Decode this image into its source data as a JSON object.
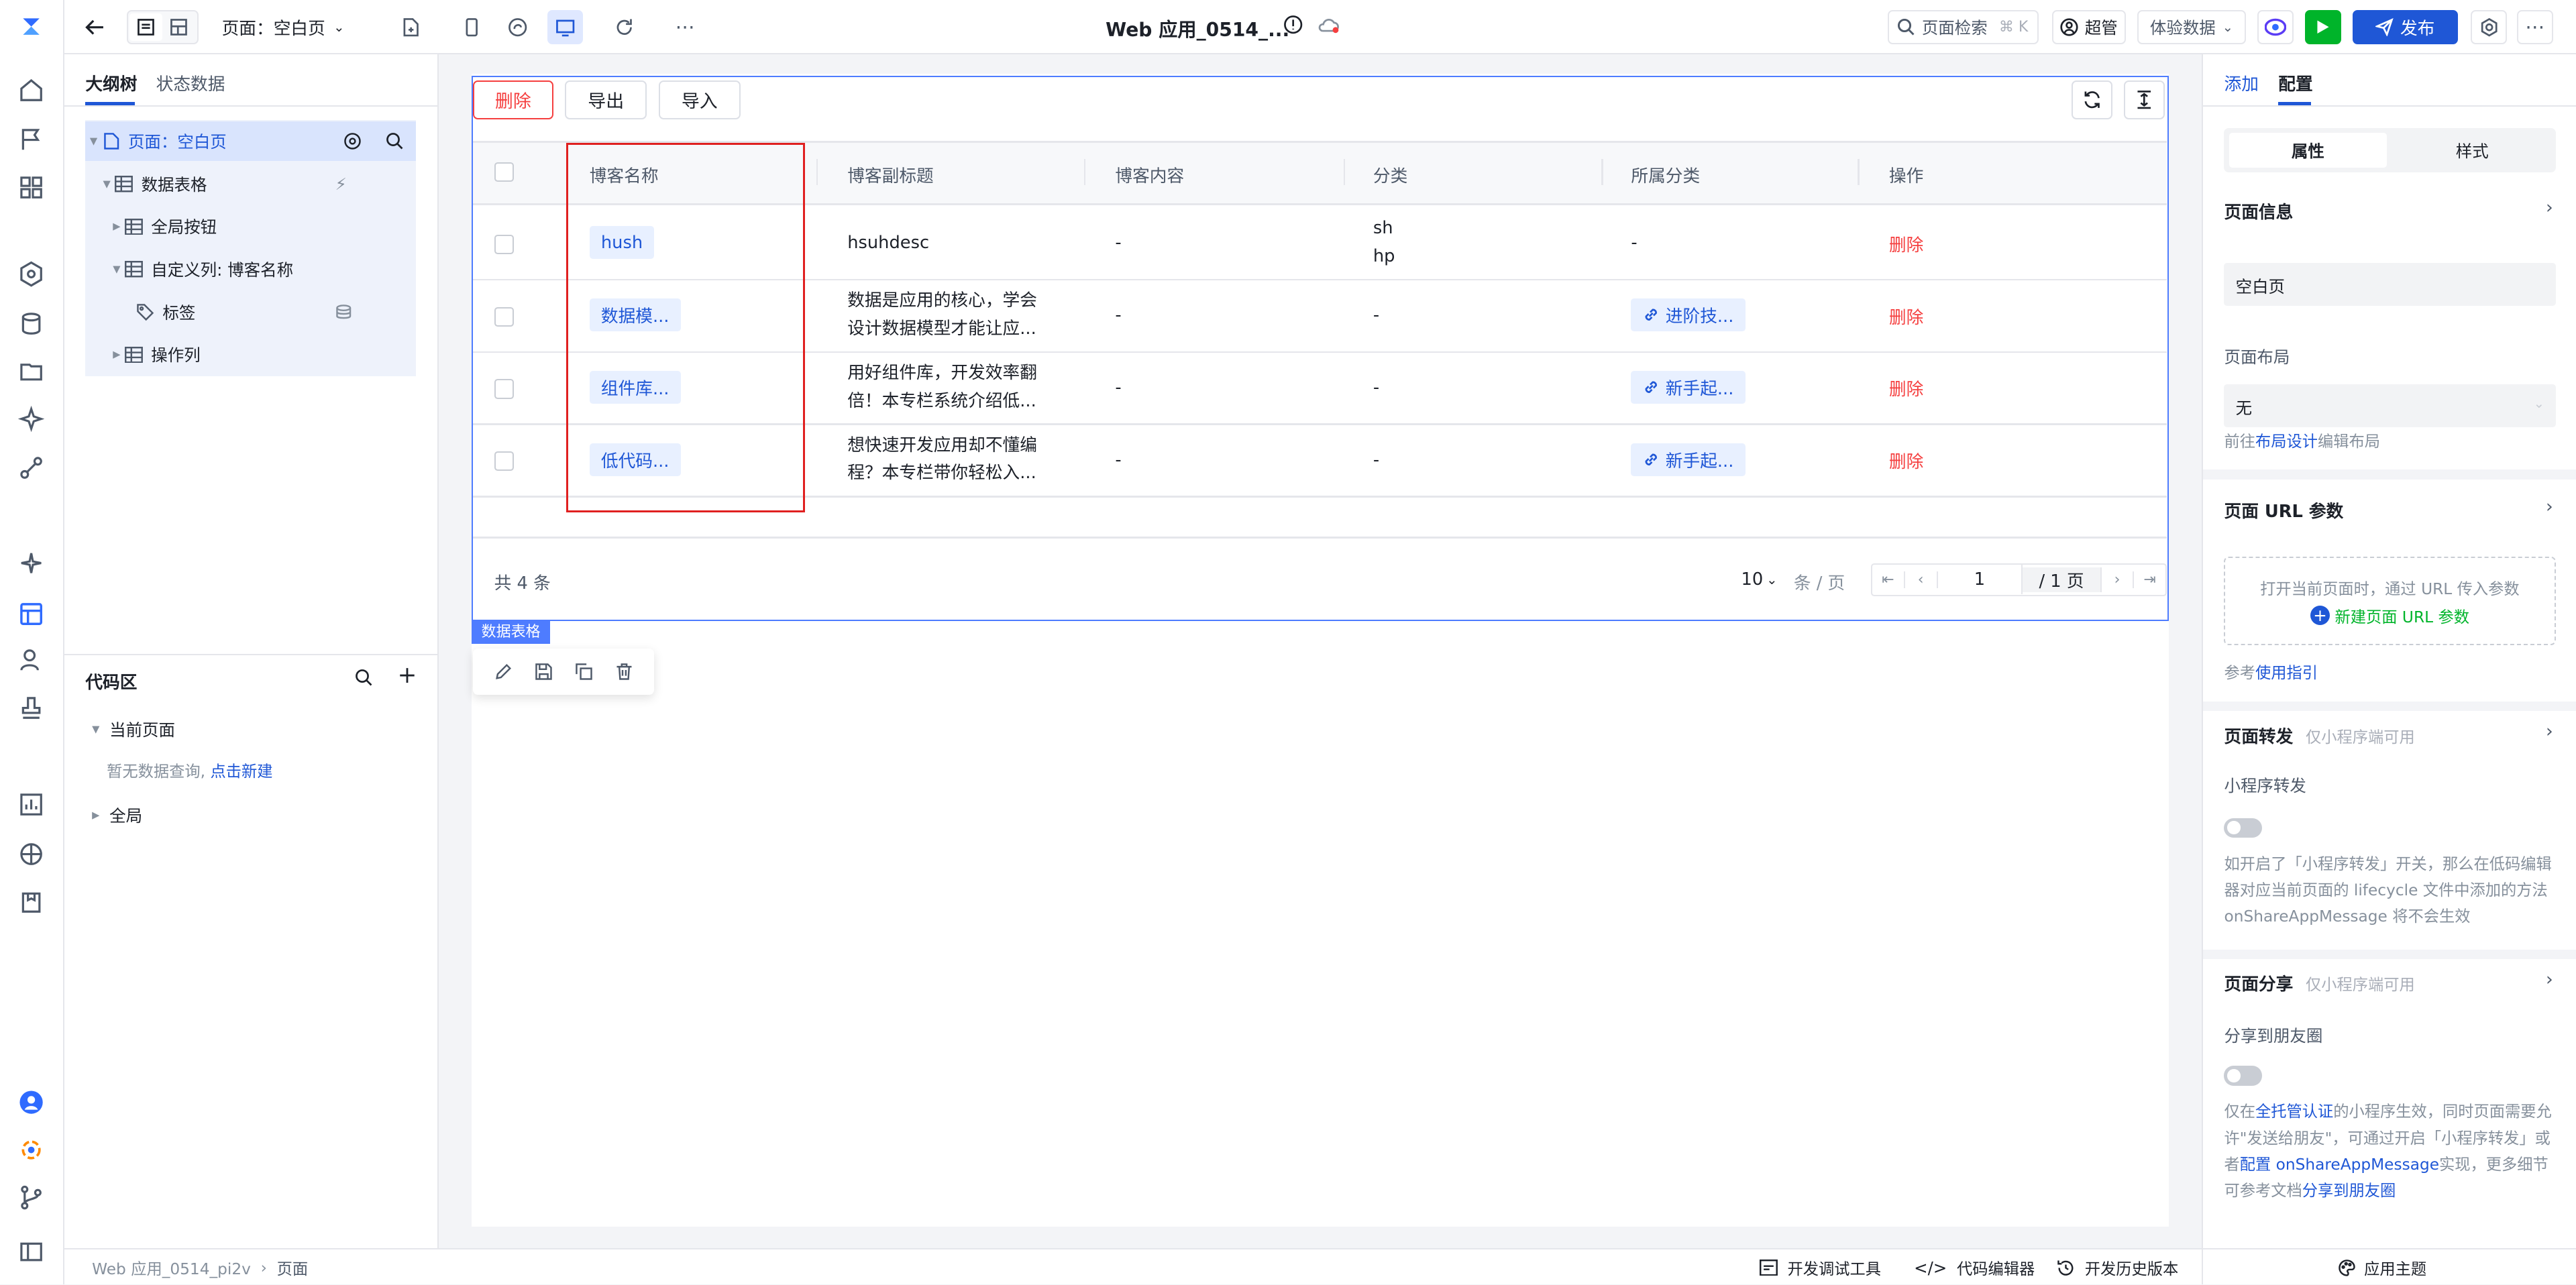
{
  "topbar": {
    "page_selector": "页面：空白页",
    "app_title": "Web 应用_0514_...",
    "search_label": "页面检索",
    "search_shortcut": "⌘ K",
    "user_label": "超管",
    "data_mode": "体验数据",
    "publish_label": "发布"
  },
  "outline": {
    "tabs": [
      "大纲树",
      "状态数据"
    ],
    "tree": [
      {
        "label": "页面：空白页"
      },
      {
        "label": "数据表格"
      },
      {
        "label": "全局按钮"
      },
      {
        "label": "自定义列: 博客名称"
      },
      {
        "label": "标签"
      },
      {
        "label": "操作列"
      }
    ],
    "code_title": "代码区",
    "current_page": "当前页面",
    "empty_hint": "暂无数据查询,",
    "create_link": "点击新建",
    "global": "全局"
  },
  "table": {
    "buttons": [
      "删除",
      "导出",
      "导入"
    ],
    "columns": [
      "博客名称",
      "博客副标题",
      "博客内容",
      "分类",
      "所属分类",
      "操作"
    ],
    "rows": [
      {
        "name": "hush",
        "subtitle1": "hsuhdesc",
        "subtitle2": "",
        "content": "-",
        "cat1": "sh",
        "cat2": "hp",
        "belong": "-",
        "op": "删除"
      },
      {
        "name": "数据模...",
        "subtitle1": "数据是应用的核心，学会",
        "subtitle2": "设计数据模型才能让应...",
        "content": "-",
        "cat1": "-",
        "cat2": "",
        "belong": "进阶技...",
        "op": "删除"
      },
      {
        "name": "组件库...",
        "subtitle1": "用好组件库，开发效率翻",
        "subtitle2": "倍！本专栏系统介绍低...",
        "content": "-",
        "cat1": "-",
        "cat2": "",
        "belong": "新手起...",
        "op": "删除"
      },
      {
        "name": "低代码...",
        "subtitle1": "想快速开发应用却不懂编",
        "subtitle2": "程？本专栏带你轻松入...",
        "content": "-",
        "cat1": "-",
        "cat2": "",
        "belong": "新手起...",
        "op": "删除"
      }
    ],
    "total": "共 4 条",
    "page_size": "10",
    "per_page": "条 / 页",
    "page_input": "1",
    "page_total": "/ 1 页",
    "component_tag": "数据表格"
  },
  "right": {
    "tabs": [
      "添加",
      "配置"
    ],
    "seg": [
      "属性",
      "样式"
    ],
    "page_info": "页面信息",
    "page_name_value": "空白页",
    "layout_label": "页面布局",
    "layout_value": "无",
    "layout_hint_pre": "前往",
    "layout_hint_link": "布局设计",
    "layout_hint_post": "编辑布局",
    "url_params": "页面 URL 参数",
    "url_hint": "打开当前页面时，通过 URL 传入参数",
    "url_new": "新建页面 URL 参数",
    "ref_pre": "参考",
    "ref_link": "使用指引",
    "forward_title": "页面转发",
    "forward_sub": "仅小程序端可用",
    "forward_label": "小程序转发",
    "forward_desc": "如开启了「小程序转发」开关，那么在低码编辑器对应当前页面的 lifecycle 文件中添加的方法 onShareAppMessage 将不会生效",
    "share_title": "页面分享",
    "share_sub": "仅小程序端可用",
    "share_label": "分享到朋友圈",
    "share_desc_pre": "仅在",
    "share_desc_link1": "全托管认证",
    "share_desc_mid": "的小程序生效，同时页面需要允许\"发送给朋友\"，可通过开启「小程序转发」或者",
    "share_desc_link2": "配置 onShareAppMessage",
    "share_desc_post": "实现，更多细节可参考文档",
    "share_desc_link3": "分享到朋友圈"
  },
  "bottom": {
    "crumb_app": "Web 应用_0514_pi2v",
    "crumb_page": "页面",
    "dev_tools": "开发调试工具",
    "code_editor": "代码编辑器",
    "history": "开发历史版本",
    "theme": "应用主题"
  },
  "colors": {
    "accent": "#1f57d6",
    "danger": "#f53f3f",
    "selection": "#4e7cff",
    "highlight_box": "#e02020"
  }
}
